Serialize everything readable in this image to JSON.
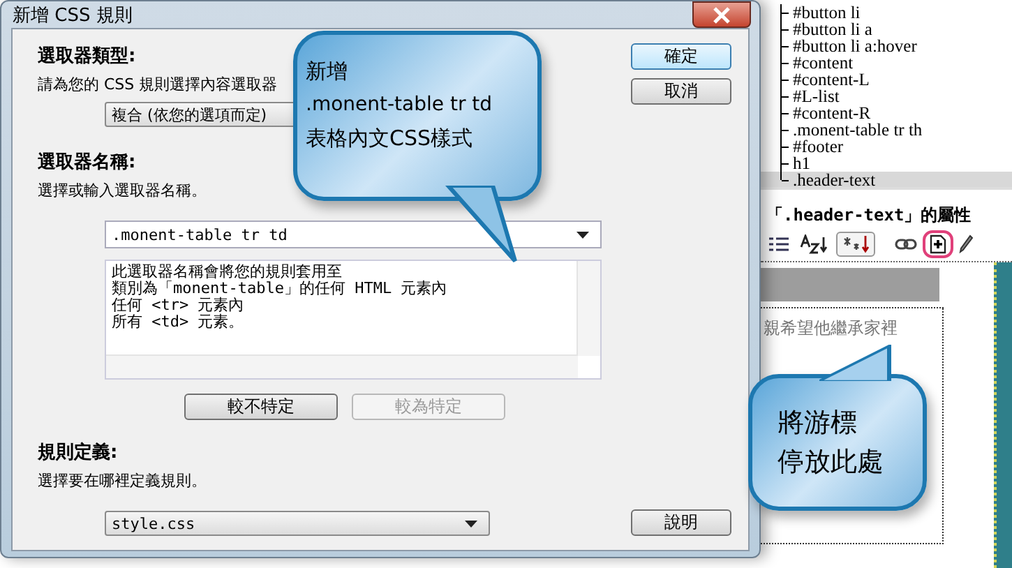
{
  "dialog": {
    "title": "新增 CSS 規則",
    "selector_type": {
      "heading": "選取器類型:",
      "hint": "請為您的 CSS 規則選擇內容選取器",
      "value": "複合 (依您的選項而定)"
    },
    "selector_name": {
      "heading": "選取器名稱:",
      "hint": "選擇或輸入選取器名稱。",
      "value": ".monent-table tr td",
      "description": [
        "此選取器名稱會將您的規則套用至",
        "類別為「monent-table」的任何 HTML 元素內",
        "任何 <tr> 元素內",
        "所有 <td> 元素。"
      ],
      "buttons": [
        {
          "label": "較不特定",
          "disabled": false
        },
        {
          "label": "較為特定",
          "disabled": true
        }
      ]
    },
    "rule_definition": {
      "heading": "規則定義:",
      "hint": "選擇要在哪裡定義規則。",
      "value": "style.css"
    },
    "side_buttons": [
      {
        "label": "確定",
        "default": true
      },
      {
        "label": "取消",
        "default": false
      }
    ],
    "help_button": "說明"
  },
  "css_panel": {
    "rules": [
      {
        "label": "#button li",
        "selected": false
      },
      {
        "label": "#button li a",
        "selected": false
      },
      {
        "label": "#button li a:hover",
        "selected": false
      },
      {
        "label": "#content",
        "selected": false
      },
      {
        "label": "#content-L",
        "selected": false
      },
      {
        "label": "#L-list",
        "selected": false
      },
      {
        "label": "#content-R",
        "selected": false
      },
      {
        "label": ".monent-table tr th",
        "selected": false
      },
      {
        "label": "#footer",
        "selected": false
      },
      {
        "label": "h1",
        "selected": false
      },
      {
        "label": ".header-text",
        "selected": true
      }
    ],
    "properties_title": "「.header-text」的屬性",
    "toolbar": [
      {
        "kind": "category",
        "pressed": false
      },
      {
        "kind": "alpha",
        "pressed": false
      },
      {
        "kind": "set",
        "pressed": true
      },
      {
        "kind": "attach",
        "pressed": false
      },
      {
        "kind": "new",
        "pressed": false,
        "highlighted": true
      },
      {
        "kind": "edit",
        "pressed": false
      }
    ]
  },
  "design_view": {
    "text": "親希望他繼承家裡"
  },
  "callouts": [
    {
      "lines": [
        "新增",
        ".monent-table tr td",
        "表格內文CSS樣式"
      ]
    },
    {
      "lines": [
        "將游標",
        "停放此處"
      ]
    }
  ]
}
